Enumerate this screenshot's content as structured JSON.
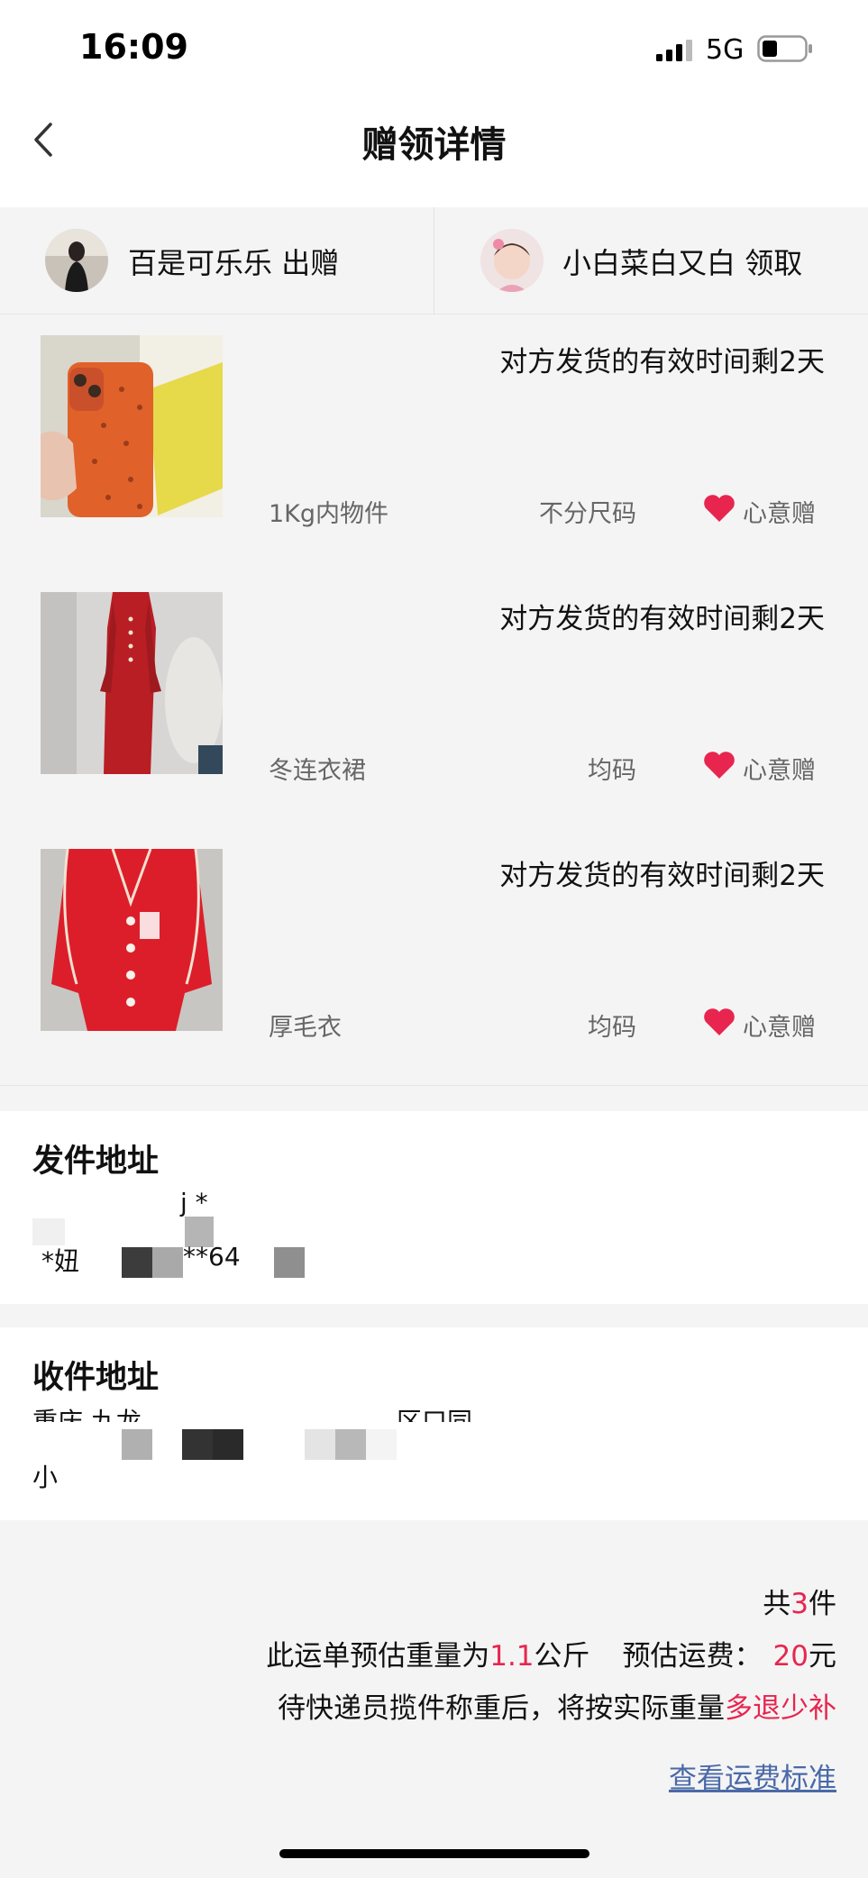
{
  "status": {
    "time": "16:09",
    "network": "5G"
  },
  "nav": {
    "title": "赠领详情"
  },
  "users": {
    "giver": {
      "name": "百是可乐乐",
      "action": "出赠"
    },
    "receiver": {
      "name": "小白菜白又白",
      "action": "领取"
    }
  },
  "items": [
    {
      "deadline": "对方发货的有效时间剩2天",
      "name": "1Kg内物件",
      "size": "不分尺码",
      "gift_type": "心意赠"
    },
    {
      "deadline": "对方发货的有效时间剩2天",
      "name": "冬连衣裙",
      "size": "均码",
      "gift_type": "心意赠"
    },
    {
      "deadline": "对方发货的有效时间剩2天",
      "name": "厚毛衣",
      "size": "均码",
      "gift_type": "心意赠"
    }
  ],
  "sender_address": {
    "title": "发件地址",
    "line1": "j *",
    "line2_prefix": "*妞",
    "line2_suffix": "**64"
  },
  "receiver_address": {
    "title": "收件地址",
    "line1": "重庆 九龙",
    "line1_tail": "区口同",
    "line2": "小"
  },
  "summary": {
    "count_prefix": "共",
    "count": "3",
    "count_suffix": "件",
    "weight_prefix": "此运单预估重量为",
    "weight": "1.1",
    "weight_unit": "公斤",
    "fee_label": "预估运费：",
    "fee": "20",
    "fee_unit": "元",
    "note_prefix": "待快递员揽件称重后，将按实际重量",
    "note_highlight": "多退少补",
    "link": "查看运费标准"
  },
  "colors": {
    "accent": "#e8254e",
    "link": "#4a69a8",
    "background": "#f4f4f4"
  }
}
